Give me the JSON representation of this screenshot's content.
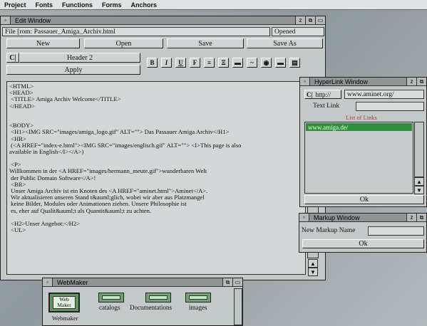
{
  "menubar": {
    "items": [
      "Project",
      "Fonts",
      "Functions",
      "Forms",
      "Anchors"
    ]
  },
  "edit_window": {
    "title": "Edit Window",
    "file_label": "File [rom: Passauer_Amiga_Archiv.html",
    "status": "Opened",
    "buttons": {
      "new": "New",
      "open": "Open",
      "save": "Save",
      "save_as": "Save As"
    },
    "cycle_icon": "C|",
    "heading_select": "Header 2",
    "apply": "Apply",
    "format_buttons": [
      "B",
      "I",
      "U",
      "F",
      "≡",
      "Ξ",
      "▬",
      "~",
      "◉",
      "▬",
      "▤"
    ],
    "lines": [
      "<HTML>",
      "<HEAD>",
      " <TITLE> Amiga Archiv Welcome</TITLE>",
      "</HEAD>",
      "",
      "",
      "<BODY>",
      " <H1><IMG SRC=\"images/amiga_logo.gif\" ALT=\"\"> Das Passauer Amiga Archiv</H1>",
      " <HR>",
      " (<A HREF=\"index-e.html\"><IMG SRC=\"images/englisch.gif\" ALT=\"\"> <I>This page is also",
      "available in English</I></A>)",
      "",
      " <P>",
      "Willkommen in der <A HREF=\"images/hermann_meute.gif\">wunderbaren Welt",
      " der Public Domain Software</A>!",
      " <BR>",
      " Unser Amiga Archiv ist ein Knoten des <A HREF=\"aminet.html\">Aminet</A>.",
      " Wir aktualisieren unseren Stand t&auml;glich, wobei wir aber aus Platzmangel",
      " keine Bilder, Modules oder Animationen ziehen. Unsere Philosophie ist",
      " es, eher auf Qualit&auml;t als Quantit&auml;t zu achten.",
      "",
      " <H2>Unser Angebot:</H2>",
      " <UL>"
    ]
  },
  "hyperlink_window": {
    "title": "HyperLink Window",
    "protocol": "http://",
    "url": "www.aminet.org/",
    "text_link_label": "Text Link",
    "text_link_value": "",
    "list_title": "List of Links",
    "links": [
      "www.amiga.de/"
    ],
    "ok": "Ok"
  },
  "markup_window": {
    "title": "Markup Window",
    "name_label": "New Markup Name",
    "name_value": "",
    "ok": "Ok"
  },
  "webmaker_window": {
    "title": "WebMaker",
    "main_icon_label": "Webmaker",
    "main_icon_caption": "Web Maker",
    "drawers": [
      "catalogs",
      "Documentations",
      "images"
    ]
  },
  "colors": {
    "selection": "#2f8f3c",
    "list_title": "#c0392b",
    "window_bg": "#c3c8c9"
  }
}
